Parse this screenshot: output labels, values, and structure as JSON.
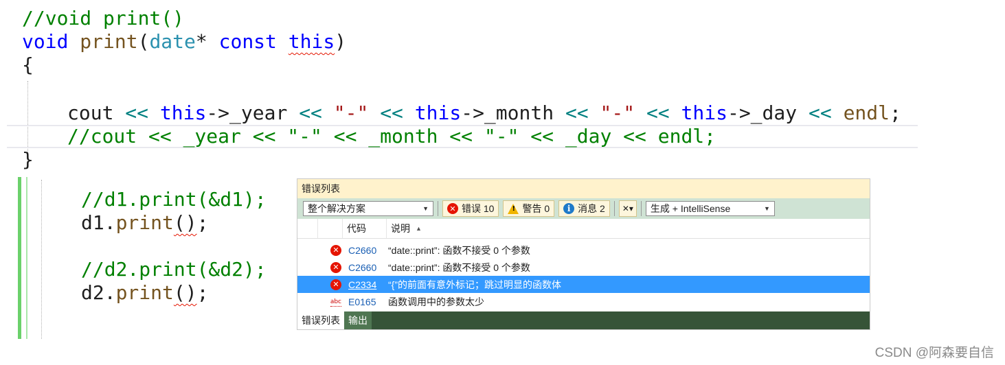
{
  "code": {
    "lines": {
      "l1": "//void print()",
      "l2_void": "void",
      "l2_print": "print",
      "l2_paren": "(",
      "l2_date": "date",
      "l2_star": "* ",
      "l2_const": "const",
      "l2_this": "this",
      "l2_close": ")",
      "l3": "{",
      "l5": {
        "cout": "cout",
        "op1": "<<",
        "this1": "this",
        "year": "->_year",
        "op2": "<<",
        "s1": "\"-\"",
        "op3": "<<",
        "this2": "this",
        "month": "->_month",
        "op4": "<<",
        "s2": "\"-\"",
        "op5": "<<",
        "this3": "this",
        "day": "->_day",
        "op6": "<<",
        "endl": "endl",
        "semi": ";"
      },
      "l6": "//cout << _year << \"-\" << _month << \"-\" << _day << endl;",
      "l7": "}",
      "l9": "//d1.print(&d1);",
      "l10_obj": "d1.",
      "l10_fn": "print",
      "l10_args": "()",
      "l10_semi": ";",
      "l12": "//d2.print(&d2);",
      "l13_obj": "d2.",
      "l13_fn": "print",
      "l13_args": "()",
      "l13_semi": ";"
    }
  },
  "error_list": {
    "title": "错误列表",
    "scope_dropdown": "整个解决方案",
    "errors_label": "错误 10",
    "warnings_label": "警告 0",
    "messages_label": "消息 2",
    "build_dropdown": "生成 + IntelliSense",
    "col_code": "代码",
    "col_desc": "说明",
    "rows": [
      {
        "code": "C2660",
        "desc": "“date::print”: 函数不接受 0 个参数",
        "icon": "error-icon"
      },
      {
        "code": "C2660",
        "desc": "“date::print”: 函数不接受 0 个参数",
        "icon": "error-icon"
      },
      {
        "code": "C2334",
        "desc": "“{”的前面有意外标记；跳过明显的函数体",
        "icon": "error-icon"
      },
      {
        "code": "E0165",
        "desc": "函数调用中的参数太少",
        "icon": "intellisense-abc-icon"
      }
    ],
    "tabs": [
      "错误列表",
      "输出"
    ]
  },
  "watermark": "CSDN @阿森要自信"
}
